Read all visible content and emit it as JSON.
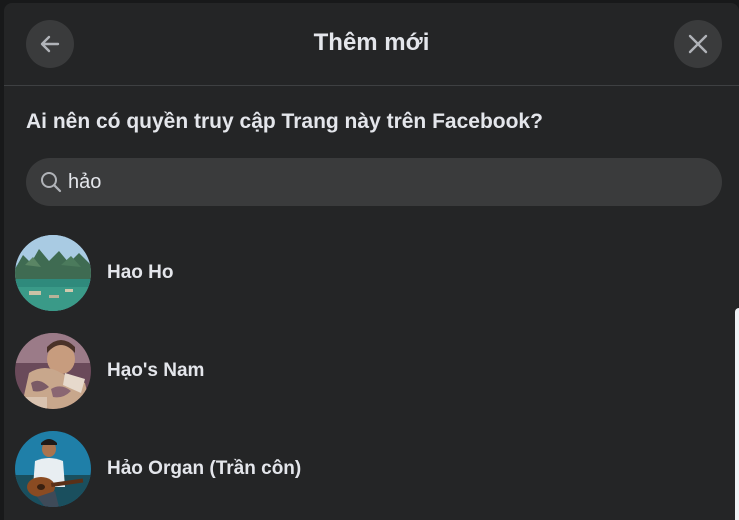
{
  "dialog": {
    "title": "Thêm mới",
    "question": "Ai nên có quyền truy cập Trang này trên Facebook?",
    "back_icon": "arrow-left-icon",
    "close_icon": "close-icon"
  },
  "search": {
    "value": "hảo",
    "icon": "search-icon"
  },
  "results": [
    {
      "name": "Hao Ho",
      "avatar": "landscape-bay-photo"
    },
    {
      "name": "Hạo's Nam",
      "avatar": "tattooed-person-photo"
    },
    {
      "name": "Hảo Organ (Trần côn)",
      "avatar": "guitar-player-photo"
    }
  ],
  "colors": {
    "background": "#242526",
    "surface": "#3a3b3c",
    "text": "#e4e6eb",
    "divider": "#3e4042"
  }
}
